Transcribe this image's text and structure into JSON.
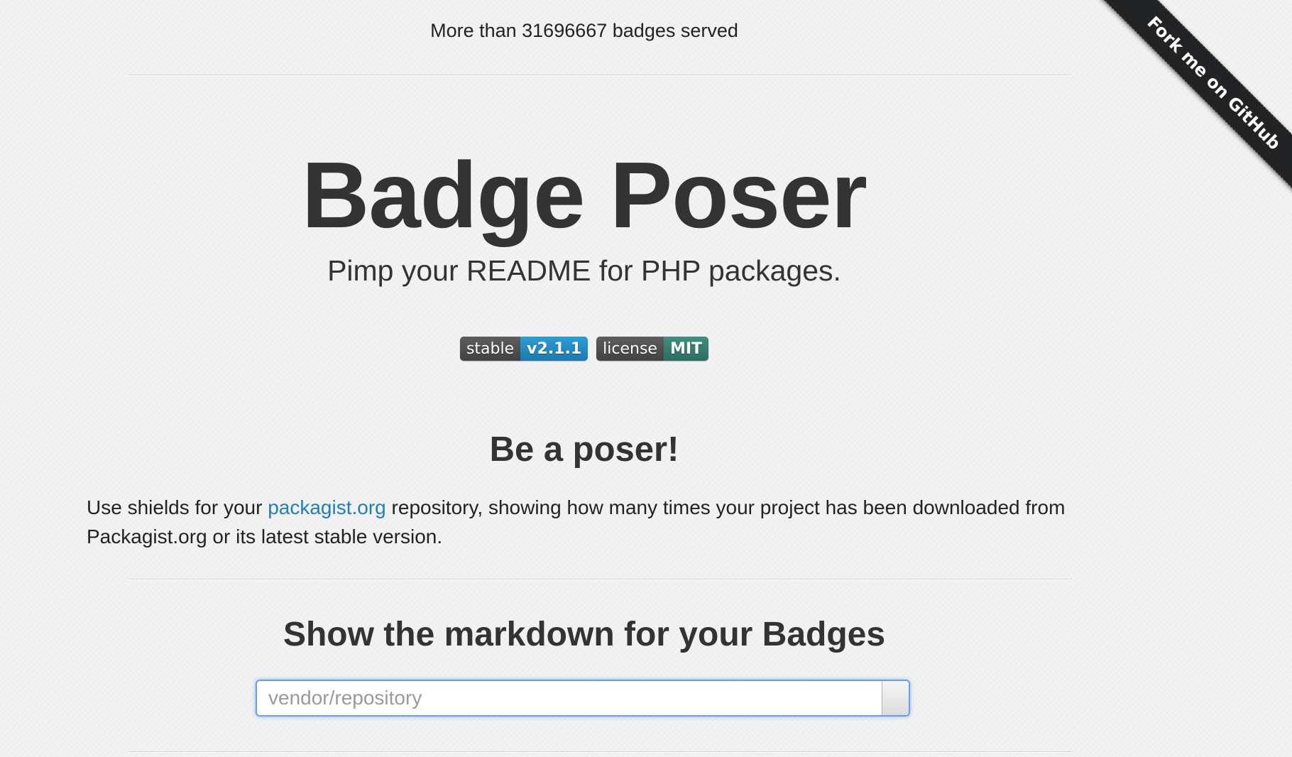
{
  "header": {
    "counter_text": "More than 31696667 badges served"
  },
  "hero": {
    "title": "Badge Poser",
    "subtitle": "Pimp your README for PHP packages."
  },
  "badges": [
    {
      "label": "stable",
      "value": "v2.1.1",
      "color": "#2a8fc9"
    },
    {
      "label": "license",
      "value": "MIT",
      "color": "#3a8474"
    }
  ],
  "intro": {
    "heading": "Be a poser!",
    "text_before_link": "Use shields for your ",
    "link_text": "packagist.org",
    "text_after_link": " repository, showing how many times your project has been downloaded from Packagist.org or its latest stable version."
  },
  "markdown": {
    "heading": "Show the markdown for your Badges",
    "input_placeholder": "vendor/repository"
  },
  "ribbon": {
    "label": "Fork me on GitHub"
  }
}
